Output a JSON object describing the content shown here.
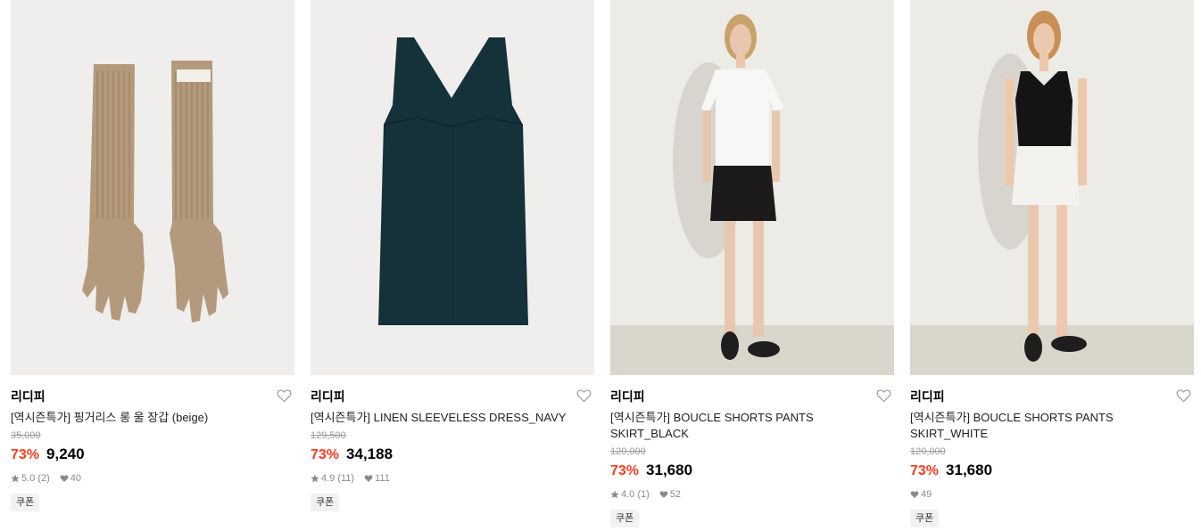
{
  "products": [
    {
      "brand": "리디피",
      "title": "[역시즌특가] 핑거리스 롱 울 장갑 (beige)",
      "title_line2": "",
      "original_price": "35,000",
      "discount": "73%",
      "price": "9,240",
      "rating": "5.0 (2)",
      "likes": "40",
      "coupon": "쿠폰",
      "image": "beige knit long gloves"
    },
    {
      "brand": "리디피",
      "title": "[역시즌특가] LINEN SLEEVELESS DRESS_NAVY",
      "title_line2": "",
      "original_price": "129,500",
      "discount": "73%",
      "price": "34,188",
      "rating": "4.9 (11)",
      "likes": "111",
      "coupon": "쿠폰",
      "image": "navy sleeveless v-neck dress"
    },
    {
      "brand": "리디피",
      "title": "[역시즌특가] BOUCLE SHORTS PANTS",
      "title_line2": "SKIRT_BLACK",
      "original_price": "120,000",
      "discount": "73%",
      "price": "31,680",
      "rating": "4.0 (1)",
      "likes": "52",
      "coupon": "쿠폰",
      "image": "model in white tee and black mini skirt"
    },
    {
      "brand": "리디피",
      "title": "[역시즌특가] BOUCLE SHORTS PANTS",
      "title_line2": "SKIRT_WHITE",
      "original_price": "120,000",
      "discount": "73%",
      "price": "31,680",
      "rating": "",
      "likes": "49",
      "coupon": "쿠폰",
      "image": "model in black tank top and white mini skirt"
    }
  ],
  "colors": {
    "discount": "#ff3b1f",
    "muted": "#9a9a9a",
    "coupon_bg": "#f2f2f2"
  },
  "icons": {
    "wishlist": "heart-outline-icon",
    "rating": "star-icon",
    "likes": "heart-icon"
  }
}
